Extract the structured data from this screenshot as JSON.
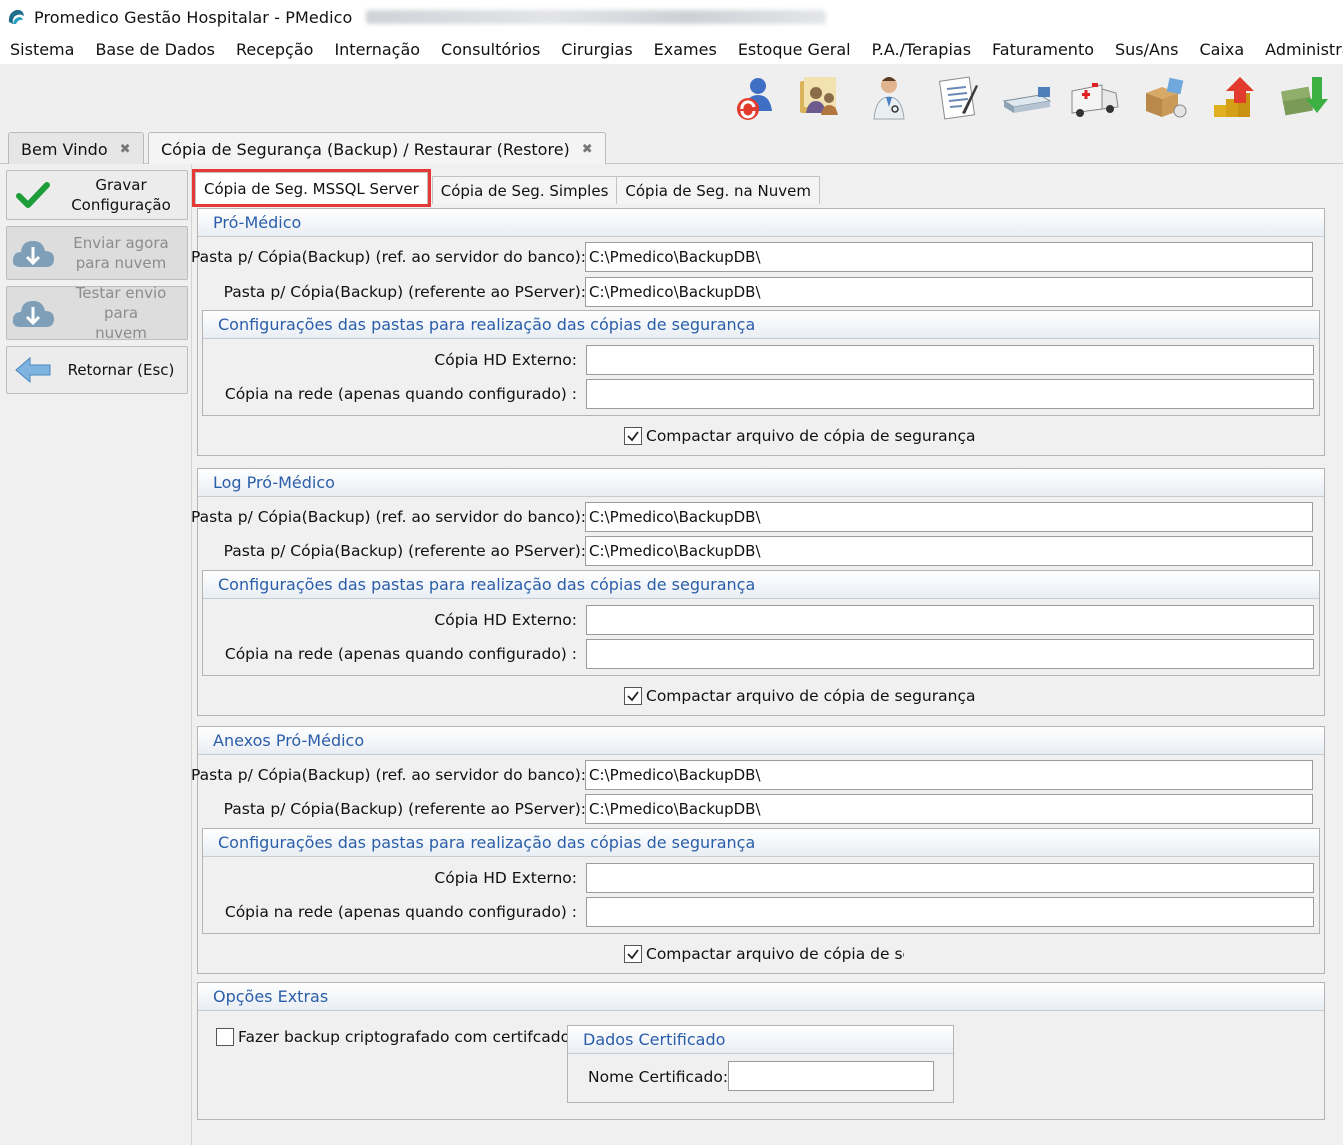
{
  "window": {
    "title": "Promedico Gestão Hospitalar - PMedico"
  },
  "menu": [
    "Sistema",
    "Base de Dados",
    "Recepção",
    "Internação",
    "Consultórios",
    "Cirurgias",
    "Exames",
    "Estoque Geral",
    "P.A./Terapias",
    "Faturamento",
    "Sus/Ans",
    "Caixa",
    "Administração"
  ],
  "toolbar_icons": [
    "sync-users-icon",
    "contacts-folder-icon",
    "doctor-icon",
    "prescription-document-icon",
    "hospital-bed-icon",
    "ambulance-icon",
    "stock-boxes-icon",
    "finance-up-icon",
    "finance-down-icon"
  ],
  "doc_tabs": [
    {
      "label": "Bem Vindo"
    },
    {
      "label": "Cópia de Segurança (Backup) / Restaurar (Restore)"
    }
  ],
  "sidebar": {
    "save": "Gravar\nConfiguração",
    "send_cloud": "Enviar agora\npara nuvem",
    "test_cloud": "Testar envio para\nnuvem",
    "back": "Retornar (Esc)"
  },
  "subtabs": [
    "Cópia de Seg. MSSQL Server",
    "Cópia de Seg. Simples",
    "Cópia de Seg. na Nuvem"
  ],
  "labels": {
    "path_db": "Pasta p/ Cópia(Backup) (ref. ao servidor do banco):",
    "path_pserver": "Pasta p/ Cópia(Backup) (referente ao PServer):",
    "folders_config": "Configurações das pastas para realização das cópias de segurança",
    "hd_ext": "Cópia HD Externo:",
    "network": "Cópia na rede (apenas quando configurado) :"
  },
  "groups": [
    {
      "title": "Pró-Médico",
      "path_db": "C:\\Pmedico\\BackupDB\\",
      "path_pserver": "C:\\Pmedico\\BackupDB\\",
      "hd_ext": "",
      "network": "",
      "compress_label": "Compactar arquivo de cópia de segurança"
    },
    {
      "title": "Log Pró-Médico",
      "path_db": "C:\\Pmedico\\BackupDB\\",
      "path_pserver": "C:\\Pmedico\\BackupDB\\",
      "hd_ext": "",
      "network": "",
      "compress_label": "Compactar arquivo de cópia de segurança"
    },
    {
      "title": "Anexos Pró-Médico",
      "path_db": "C:\\Pmedico\\BackupDB\\",
      "path_pserver": "C:\\Pmedico\\BackupDB\\",
      "hd_ext": "",
      "network": "",
      "compress_label": "Compactar arquivo de cópia de seç"
    }
  ],
  "extras": {
    "title": "Opções Extras",
    "encrypt_label": "Fazer backup criptografado com certifcado",
    "cert_title": "Dados Certificado",
    "cert_name_label": "Nome Certificado:",
    "cert_name": ""
  }
}
